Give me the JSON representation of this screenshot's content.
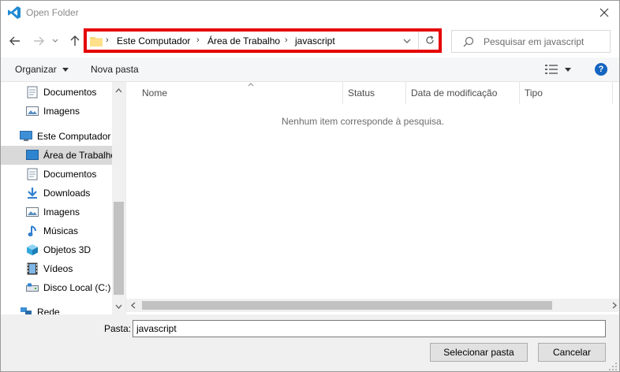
{
  "window": {
    "title": "Open Folder"
  },
  "address": {
    "crumbs": [
      "Este Computador",
      "Área de Trabalho",
      "javascript"
    ]
  },
  "search": {
    "placeholder": "Pesquisar em javascript"
  },
  "toolbar": {
    "organize_label": "Organizar",
    "new_folder_label": "Nova pasta"
  },
  "sidebar": {
    "items": [
      {
        "label": "Documentos",
        "icon": "document-icon"
      },
      {
        "label": "Imagens",
        "icon": "image-icon"
      },
      {
        "label": "Este Computador",
        "icon": "computer-icon"
      },
      {
        "label": "Área de Trabalho",
        "icon": "desktop-icon"
      },
      {
        "label": "Documentos",
        "icon": "document-icon"
      },
      {
        "label": "Downloads",
        "icon": "download-icon"
      },
      {
        "label": "Imagens",
        "icon": "image-icon"
      },
      {
        "label": "Músicas",
        "icon": "music-icon"
      },
      {
        "label": "Objetos 3D",
        "icon": "cube-icon"
      },
      {
        "label": "Vídeos",
        "icon": "video-icon"
      },
      {
        "label": "Disco Local (C:)",
        "icon": "drive-icon"
      },
      {
        "label": "Rede",
        "icon": "network-icon"
      }
    ]
  },
  "filelist": {
    "columns": [
      "Nome",
      "Status",
      "Data de modificação",
      "Tipo"
    ],
    "empty_message": "Nenhum item corresponde à pesquisa."
  },
  "footer": {
    "folder_label": "Pasta:",
    "folder_value": "javascript",
    "select_button": "Selecionar pasta",
    "cancel_button": "Cancelar"
  },
  "colors": {
    "highlight_border": "#e60000",
    "selected_item_bg": "#d9d9d9",
    "help_icon": "#1565c0"
  }
}
